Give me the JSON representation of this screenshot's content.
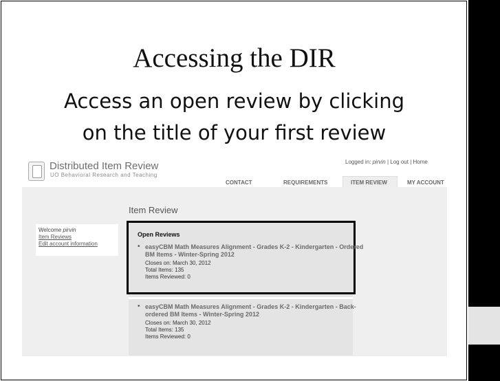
{
  "slide": {
    "title": "Accessing the DIR",
    "subtitle_line1": "Access an open review by clicking",
    "subtitle_line2": "on the title of your first review"
  },
  "site": {
    "title": "Distributed Item Review",
    "subtitle": "UO Behavioral Research and Teaching",
    "logged_in_label": "Logged in:",
    "username": "pirvin",
    "logout": "Log out",
    "home": "Home",
    "separator": "|"
  },
  "nav": [
    "CONTACT",
    "REQUIREMENTS",
    "ITEM REVIEW",
    "MY ACCOUNT"
  ],
  "page_heading": "Item Review",
  "sidebar": {
    "welcome": "Welcome",
    "username": "pirvin",
    "links": [
      "Item Reviews",
      "Edit account information"
    ]
  },
  "open_reviews": {
    "label": "Open Reviews",
    "items": [
      {
        "title": "easyCBM Math Measures Alignment - Grades K-2 - Kindergarten - Ordered BM Items - Winter-Spring 2012",
        "closes": "Closes on: March 30, 2012",
        "total": "Total Items: 135",
        "reviewed": "Items Reviewed: 0"
      },
      {
        "title": "easyCBM Math Measures Alignment - Grades K-2 - Kindergarten - Back-ordered BM Items - Winter-Spring 2012",
        "closes": "Closes on: March 30, 2012",
        "total": "Total Items: 135",
        "reviewed": "Items Reviewed: 0"
      }
    ]
  },
  "colors": {
    "highlight_border": "#000000",
    "panel": "#e4e4e4",
    "band": "#efefef"
  }
}
